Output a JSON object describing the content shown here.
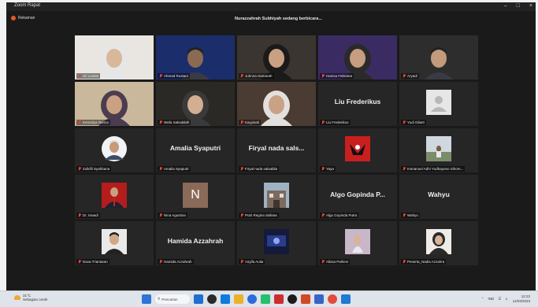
{
  "window": {
    "title": "Zoom Rapat",
    "controls": [
      "–",
      "□",
      "×"
    ]
  },
  "recording_label": "Rekaman",
  "speaker_banner": "Nurazzahrah Subhiyah sedang berbicara...",
  "participants": [
    {
      "name": "Sri Lestari",
      "kind": "video",
      "bg": "#e9e6e1",
      "skin": "#d9b79a",
      "hijab": "#e6e6e6"
    },
    {
      "name": "Ahmad Rustam",
      "kind": "video",
      "bg": "#1c2d6b",
      "skin": "#8a6a52",
      "hijab": ""
    },
    {
      "name": "Juhnna Hamarah",
      "kind": "video",
      "bg": "#3a3530",
      "skin": "#c9a182",
      "hijab": "#1a1a1a"
    },
    {
      "name": "Hanisa Febriana",
      "kind": "video",
      "bg": "#3b2b63",
      "skin": "#c79d80",
      "hijab": "#2a2a2a"
    },
    {
      "name": "Aryadi",
      "kind": "video",
      "bg": "#2d2d2d",
      "skin": "#c29a7c",
      "hijab": ""
    },
    {
      "name": "Kemaliya Nuriza",
      "kind": "video",
      "bg": "#c9b89c",
      "skin": "#caa283",
      "hijab": "#4b3d4f"
    },
    {
      "name": "Wafa Salsabilah",
      "kind": "video",
      "bg": "#2b2925",
      "skin": "#d4ae92",
      "hijab": "#3a3a3a"
    },
    {
      "name": "Kayyisah",
      "kind": "video",
      "bg": "#4a3b33",
      "skin": "#c9a184",
      "hijab": "#e2e0dd"
    },
    {
      "name": "Liu Frederikus",
      "kind": "name",
      "display": "Liu Frederikus"
    },
    {
      "name": "Yudi Gilarti",
      "kind": "avatar",
      "avatar": "gray"
    },
    {
      "name": "Zulkifli Syahbana",
      "kind": "avatar",
      "avatar": "man"
    },
    {
      "name": "Amalia Syaputri",
      "kind": "name",
      "display": "Amalia Syaputri"
    },
    {
      "name": "Firyal nada salsabila",
      "kind": "name",
      "display": "Firyal nada sals..."
    },
    {
      "name": "Yaya",
      "kind": "avatar",
      "avatar": "red"
    },
    {
      "name": "Immanuel Adhi Yudhayono Sihom...",
      "kind": "avatar",
      "avatar": "landscape"
    },
    {
      "name": "Dr. Iswadi",
      "kind": "avatar",
      "avatar": "official"
    },
    {
      "name": "Nina Agustina",
      "kind": "letter",
      "letter": "N"
    },
    {
      "name": "Putri Regina Salinas",
      "kind": "avatar",
      "avatar": "building"
    },
    {
      "name": "Algo Gopinda Putra",
      "kind": "name",
      "display": "Algo Gopinda P..."
    },
    {
      "name": "Wahyu",
      "kind": "name",
      "display": "Wahyu"
    },
    {
      "name": "Dava Triantanto",
      "kind": "avatar",
      "avatar": "boy"
    },
    {
      "name": "Hamida Azzahrah",
      "kind": "name",
      "display": "Hamida Azzahrah"
    },
    {
      "name": "Asyifa Aulia",
      "kind": "avatar",
      "avatar": "dark"
    },
    {
      "name": "Alissa Pahlevi",
      "kind": "avatar",
      "avatar": "girl"
    },
    {
      "name": "Peserta_Nadia Azzahra",
      "kind": "avatar",
      "avatar": "hijabgirl"
    }
  ],
  "taskbar": {
    "weather_temp": "31°C",
    "weather_desc": "Sebagian cerah",
    "search_label": "Pencarian",
    "lang": "IND",
    "time": "12:22",
    "date": "11/03/2023",
    "app_colors": [
      "#1f6fd1",
      "#2a2a2a",
      "#0f7cd8",
      "#e8b22a",
      "#2b6cd9",
      "#25c06b",
      "#cc2e2e",
      "#1b1b1b",
      "#d14a25",
      "#3565c8",
      "#e34b3c",
      "#1f7ad1"
    ]
  }
}
